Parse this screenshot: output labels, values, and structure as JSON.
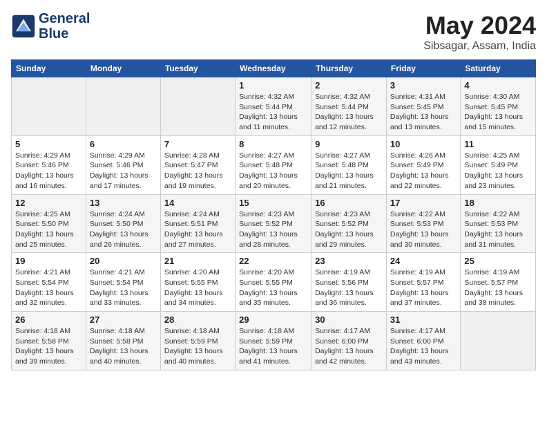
{
  "header": {
    "logo_line1": "General",
    "logo_line2": "Blue",
    "month_year": "May 2024",
    "location": "Sibsagar, Assam, India"
  },
  "days_of_week": [
    "Sunday",
    "Monday",
    "Tuesday",
    "Wednesday",
    "Thursday",
    "Friday",
    "Saturday"
  ],
  "weeks": [
    [
      {
        "day": "",
        "info": ""
      },
      {
        "day": "",
        "info": ""
      },
      {
        "day": "",
        "info": ""
      },
      {
        "day": "1",
        "info": "Sunrise: 4:32 AM\nSunset: 5:44 PM\nDaylight: 13 hours\nand 11 minutes."
      },
      {
        "day": "2",
        "info": "Sunrise: 4:32 AM\nSunset: 5:44 PM\nDaylight: 13 hours\nand 12 minutes."
      },
      {
        "day": "3",
        "info": "Sunrise: 4:31 AM\nSunset: 5:45 PM\nDaylight: 13 hours\nand 13 minutes."
      },
      {
        "day": "4",
        "info": "Sunrise: 4:30 AM\nSunset: 5:45 PM\nDaylight: 13 hours\nand 15 minutes."
      }
    ],
    [
      {
        "day": "5",
        "info": "Sunrise: 4:29 AM\nSunset: 5:46 PM\nDaylight: 13 hours\nand 16 minutes."
      },
      {
        "day": "6",
        "info": "Sunrise: 4:29 AM\nSunset: 5:46 PM\nDaylight: 13 hours\nand 17 minutes."
      },
      {
        "day": "7",
        "info": "Sunrise: 4:28 AM\nSunset: 5:47 PM\nDaylight: 13 hours\nand 19 minutes."
      },
      {
        "day": "8",
        "info": "Sunrise: 4:27 AM\nSunset: 5:48 PM\nDaylight: 13 hours\nand 20 minutes."
      },
      {
        "day": "9",
        "info": "Sunrise: 4:27 AM\nSunset: 5:48 PM\nDaylight: 13 hours\nand 21 minutes."
      },
      {
        "day": "10",
        "info": "Sunrise: 4:26 AM\nSunset: 5:49 PM\nDaylight: 13 hours\nand 22 minutes."
      },
      {
        "day": "11",
        "info": "Sunrise: 4:25 AM\nSunset: 5:49 PM\nDaylight: 13 hours\nand 23 minutes."
      }
    ],
    [
      {
        "day": "12",
        "info": "Sunrise: 4:25 AM\nSunset: 5:50 PM\nDaylight: 13 hours\nand 25 minutes."
      },
      {
        "day": "13",
        "info": "Sunrise: 4:24 AM\nSunset: 5:50 PM\nDaylight: 13 hours\nand 26 minutes."
      },
      {
        "day": "14",
        "info": "Sunrise: 4:24 AM\nSunset: 5:51 PM\nDaylight: 13 hours\nand 27 minutes."
      },
      {
        "day": "15",
        "info": "Sunrise: 4:23 AM\nSunset: 5:52 PM\nDaylight: 13 hours\nand 28 minutes."
      },
      {
        "day": "16",
        "info": "Sunrise: 4:23 AM\nSunset: 5:52 PM\nDaylight: 13 hours\nand 29 minutes."
      },
      {
        "day": "17",
        "info": "Sunrise: 4:22 AM\nSunset: 5:53 PM\nDaylight: 13 hours\nand 30 minutes."
      },
      {
        "day": "18",
        "info": "Sunrise: 4:22 AM\nSunset: 5:53 PM\nDaylight: 13 hours\nand 31 minutes."
      }
    ],
    [
      {
        "day": "19",
        "info": "Sunrise: 4:21 AM\nSunset: 5:54 PM\nDaylight: 13 hours\nand 32 minutes."
      },
      {
        "day": "20",
        "info": "Sunrise: 4:21 AM\nSunset: 5:54 PM\nDaylight: 13 hours\nand 33 minutes."
      },
      {
        "day": "21",
        "info": "Sunrise: 4:20 AM\nSunset: 5:55 PM\nDaylight: 13 hours\nand 34 minutes."
      },
      {
        "day": "22",
        "info": "Sunrise: 4:20 AM\nSunset: 5:55 PM\nDaylight: 13 hours\nand 35 minutes."
      },
      {
        "day": "23",
        "info": "Sunrise: 4:19 AM\nSunset: 5:56 PM\nDaylight: 13 hours\nand 36 minutes."
      },
      {
        "day": "24",
        "info": "Sunrise: 4:19 AM\nSunset: 5:57 PM\nDaylight: 13 hours\nand 37 minutes."
      },
      {
        "day": "25",
        "info": "Sunrise: 4:19 AM\nSunset: 5:57 PM\nDaylight: 13 hours\nand 38 minutes."
      }
    ],
    [
      {
        "day": "26",
        "info": "Sunrise: 4:18 AM\nSunset: 5:58 PM\nDaylight: 13 hours\nand 39 minutes."
      },
      {
        "day": "27",
        "info": "Sunrise: 4:18 AM\nSunset: 5:58 PM\nDaylight: 13 hours\nand 40 minutes."
      },
      {
        "day": "28",
        "info": "Sunrise: 4:18 AM\nSunset: 5:59 PM\nDaylight: 13 hours\nand 40 minutes."
      },
      {
        "day": "29",
        "info": "Sunrise: 4:18 AM\nSunset: 5:59 PM\nDaylight: 13 hours\nand 41 minutes."
      },
      {
        "day": "30",
        "info": "Sunrise: 4:17 AM\nSunset: 6:00 PM\nDaylight: 13 hours\nand 42 minutes."
      },
      {
        "day": "31",
        "info": "Sunrise: 4:17 AM\nSunset: 6:00 PM\nDaylight: 13 hours\nand 43 minutes."
      },
      {
        "day": "",
        "info": ""
      }
    ]
  ]
}
